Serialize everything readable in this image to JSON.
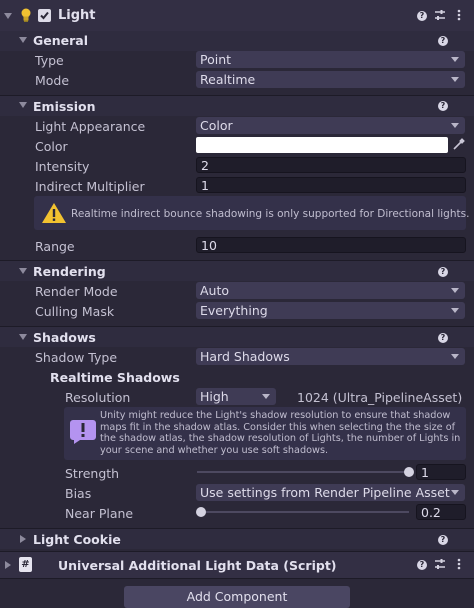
{
  "header": {
    "title": "Light",
    "enabled": true
  },
  "general": {
    "title": "General",
    "type_label": "Type",
    "type_value": "Point",
    "mode_label": "Mode",
    "mode_value": "Realtime"
  },
  "emission": {
    "title": "Emission",
    "appearance_label": "Light Appearance",
    "appearance_value": "Color",
    "color_label": "Color",
    "color_value": "#ffffff",
    "intensity_label": "Intensity",
    "intensity_value": "2",
    "indirect_label": "Indirect Multiplier",
    "indirect_value": "1",
    "warning_text": "Realtime indirect bounce shadowing is only supported for Directional lights.",
    "range_label": "Range",
    "range_value": "10"
  },
  "rendering": {
    "title": "Rendering",
    "render_mode_label": "Render Mode",
    "render_mode_value": "Auto",
    "culling_label": "Culling Mask",
    "culling_value": "Everything"
  },
  "shadows": {
    "title": "Shadows",
    "type_label": "Shadow Type",
    "type_value": "Hard Shadows",
    "realtime_title": "Realtime Shadows",
    "resolution_label": "Resolution",
    "resolution_value": "High",
    "resolution_info": "1024 (Ultra_PipelineAsset)",
    "info_text": "Unity might reduce the Light's shadow resolution to ensure that shadow maps fit in the shadow atlas. Consider this when selecting the the size of the shadow atlas, the shadow resolution of Lights, the number of Lights in your scene and whether you use soft shadows.",
    "strength_label": "Strength",
    "strength_value": "1",
    "strength_fraction": 1.0,
    "bias_label": "Bias",
    "bias_value": "Use settings from Render Pipeline Asset",
    "near_label": "Near Plane",
    "near_value": "0.2",
    "near_fraction": 0.02
  },
  "cookie": {
    "title": "Light Cookie"
  },
  "component": {
    "title": "Universal Additional Light Data (Script)"
  },
  "add_component_label": "Add Component",
  "colors": {
    "background": "#2b2838",
    "panel": "#332f44",
    "field": "#1f1d2a",
    "dropdown": "#3f3b55",
    "bulb": "#f1c232"
  }
}
